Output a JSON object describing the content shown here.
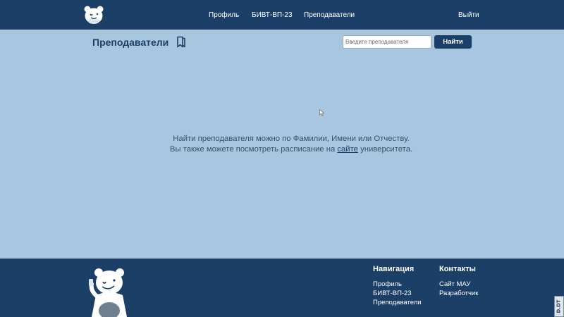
{
  "header": {
    "nav": {
      "profile": "Профиль",
      "group": "БИВТ-ВП-23",
      "teachers": "Преподаватели",
      "logout": "Выйти"
    }
  },
  "main": {
    "title": "Преподаватели",
    "search": {
      "placeholder": "Введите преподавателя",
      "value": "",
      "button_label": "Найти"
    },
    "hint": {
      "line1": "Найти преподавателя можно по Фамилии, Имени или Отчеству.",
      "line2_before": "Вы также можете посмотреть расписание на ",
      "link": "сайте",
      "line2_after": " университета."
    }
  },
  "footer": {
    "navigation": {
      "heading": "Навигация",
      "items": [
        "Профиль",
        "БИВТ-ВП-23",
        "Преподаватели"
      ]
    },
    "contacts": {
      "heading": "Контакты",
      "items": [
        "Сайт МАУ",
        "Разработчик"
      ]
    }
  },
  "watermark": "D.DT",
  "colors": {
    "primary": "#1b3f66",
    "background": "#a9c6e0"
  },
  "icons": [
    "bear-logo-icon",
    "bookmark-icon",
    "cursor-icon",
    "bear-mascot-icon"
  ]
}
